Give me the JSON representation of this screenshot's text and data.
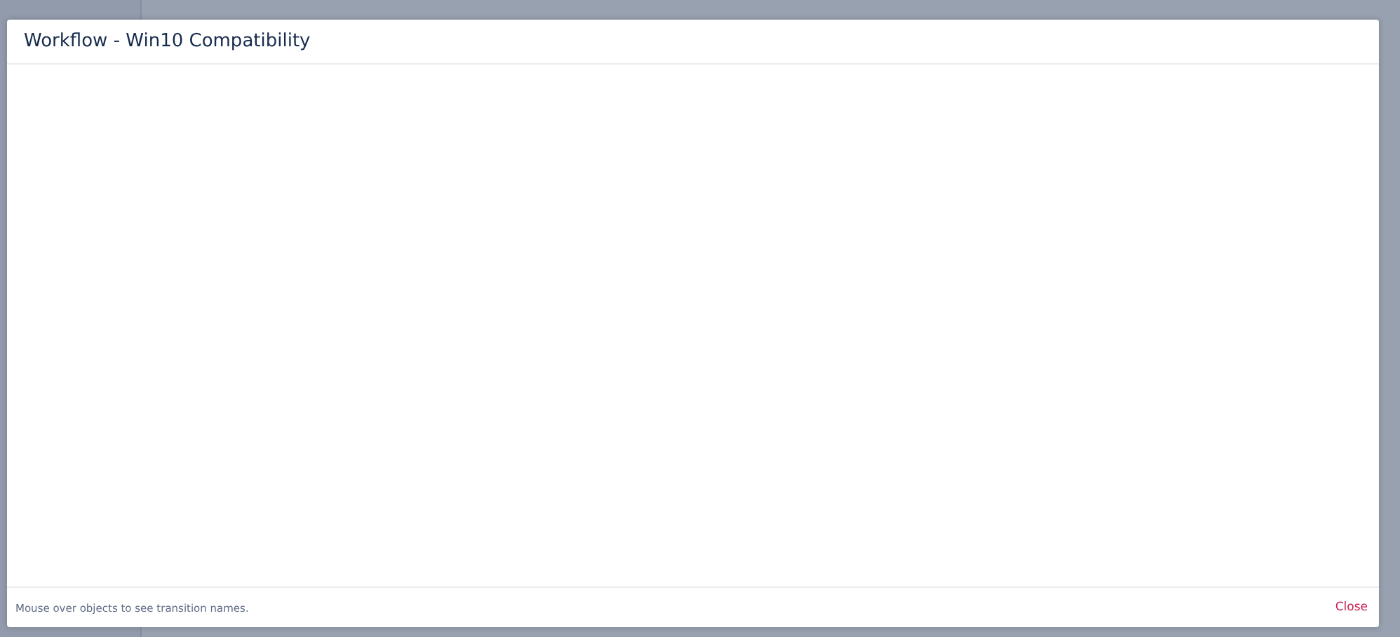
{
  "dialog": {
    "title": "Workflow - Win10 Compatibility",
    "footer_hint": "Mouse over objects to see transition names.",
    "close_button": "Close"
  }
}
